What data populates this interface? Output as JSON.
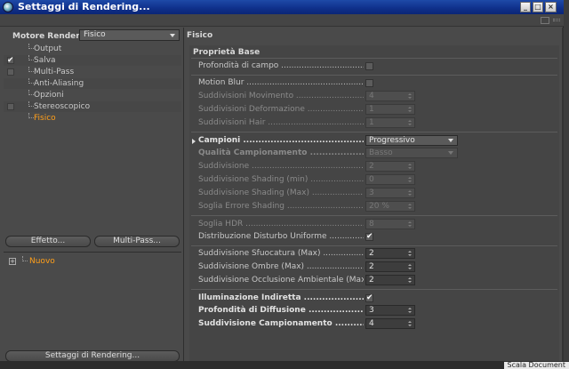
{
  "window": {
    "title": "Settaggi di Rendering..."
  },
  "left": {
    "engine_label": "Motore Render",
    "engine_value": "Fisico",
    "tree": [
      {
        "label": "Output",
        "checkbox": false,
        "checked": false,
        "selected": false
      },
      {
        "label": "Salva",
        "checkbox": true,
        "checked": true,
        "selected": false
      },
      {
        "label": "Multi-Pass",
        "checkbox": true,
        "checked": false,
        "selected": false
      },
      {
        "label": "Anti-Aliasing",
        "checkbox": false,
        "checked": false,
        "selected": false
      },
      {
        "label": "Opzioni",
        "checkbox": false,
        "checked": false,
        "selected": false
      },
      {
        "label": "Stereoscopico",
        "checkbox": true,
        "checked": false,
        "selected": false
      },
      {
        "label": "Fisico",
        "checkbox": false,
        "checked": false,
        "selected": true
      }
    ],
    "effect_button": "Effetto...",
    "multipass_button": "Multi-Pass...",
    "preset_item": "Nuovo",
    "settings_button": "Settaggi di Rendering..."
  },
  "right": {
    "section_title": "Fisico",
    "group_title": "Proprietà Base",
    "depth_of_field": {
      "label": "Profondità di campo",
      "checked": false
    },
    "motion_blur": {
      "label": "Motion Blur",
      "checked": false
    },
    "motion_subdiv": {
      "label": "Suddivisioni Movimento",
      "value": "4"
    },
    "deform_subdiv": {
      "label": "Suddivisioni Deformazione",
      "value": "1"
    },
    "hair_subdiv": {
      "label": "Suddivisioni Hair",
      "value": "1"
    },
    "samplers": {
      "label": "Campioni",
      "value": "Progressivo"
    },
    "sampling_quality": {
      "label": "Qualità Campionamento",
      "value": "Basso"
    },
    "subdivision": {
      "label": "Suddivisione",
      "value": "2"
    },
    "shading_min": {
      "label": "Suddivisione Shading (min)",
      "value": "0"
    },
    "shading_max": {
      "label": "Suddivisione Shading (Max)",
      "value": "3"
    },
    "shading_error": {
      "label": "Soglia Errore Shading",
      "value": "20 %"
    },
    "hdr_threshold": {
      "label": "Soglia HDR",
      "value": "8"
    },
    "uniform_noise": {
      "label": "Distribuzione Disturbo Uniforme",
      "checked": true
    },
    "blur_subdiv": {
      "label": "Suddivisione Sfuocatura (Max)",
      "value": "2"
    },
    "shadow_subdiv": {
      "label": "Suddivisione Ombre (Max)",
      "value": "2"
    },
    "ao_subdiv": {
      "label": "Suddivisione Occlusione Ambientale (Max)",
      "value": "2"
    },
    "indirect_light": {
      "label": "Illuminazione Indiretta",
      "checked": true
    },
    "diffuse_depth": {
      "label": "Profondità di Diffusione",
      "value": "3"
    },
    "sampling_subdiv": {
      "label": "Suddivisione Campionamento",
      "value": "4"
    }
  },
  "statusbar": {
    "text": "Scala Document"
  },
  "colors": {
    "accent": "#ff9f1a",
    "titlebar": "#1e4aa8",
    "panel": "#4a4a4a"
  }
}
